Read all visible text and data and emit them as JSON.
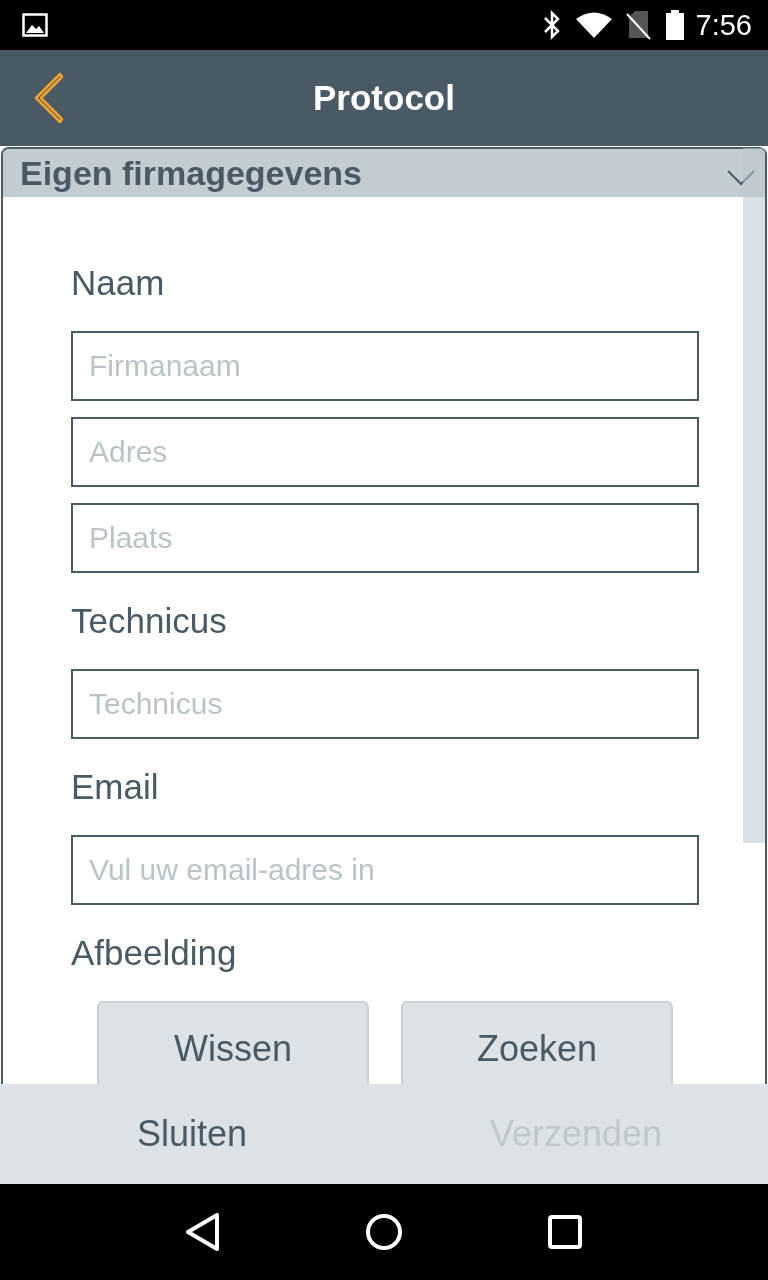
{
  "status_bar": {
    "time": "7:56"
  },
  "app_bar": {
    "title": "Protocol"
  },
  "section": {
    "title": "Eigen firmagegevens",
    "expanded": true
  },
  "groups": [
    {
      "label": "Naam",
      "fields": [
        {
          "placeholder": "Firmanaam"
        },
        {
          "placeholder": "Adres"
        },
        {
          "placeholder": "Plaats"
        }
      ]
    },
    {
      "label": "Technicus",
      "fields": [
        {
          "placeholder": "Technicus"
        }
      ]
    },
    {
      "label": "Email",
      "fields": [
        {
          "placeholder": "Vul uw email-adres in"
        }
      ]
    },
    {
      "label": "Afbeelding",
      "buttons": [
        {
          "label": "Wissen"
        },
        {
          "label": "Zoeken"
        }
      ]
    }
  ],
  "actions": [
    {
      "label": "Sluiten",
      "disabled": false
    },
    {
      "label": "Verzenden",
      "disabled": true
    }
  ]
}
